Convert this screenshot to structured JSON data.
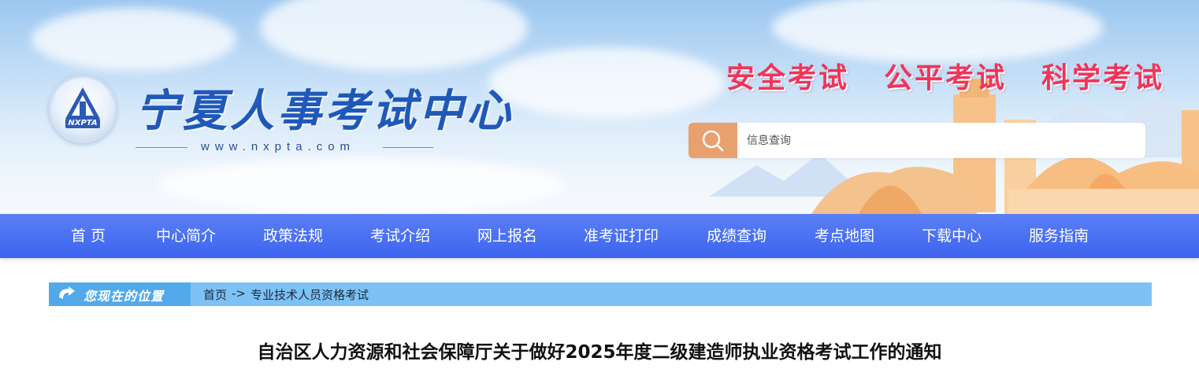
{
  "header": {
    "site_title": "宁夏人事考试中心",
    "site_url": "www.nxpta.com",
    "logo_text": "NXPTA",
    "slogans": [
      "安全考试",
      "公平考试",
      "科学考试"
    ],
    "search": {
      "placeholder": "信息查询",
      "icon": "search-icon"
    }
  },
  "nav": {
    "items": [
      "首 页",
      "中心简介",
      "政策法规",
      "考试介绍",
      "网上报名",
      "准考证打印",
      "成绩查询",
      "考点地图",
      "下载中心",
      "服务指南"
    ]
  },
  "breadcrumb": {
    "label": "您现在的位置",
    "items": [
      "首页",
      "->",
      "专业技术人员资格考试"
    ]
  },
  "article": {
    "title": "自治区人力资源和社会保障厅关于做好2025年度二级建造师执业资格考试工作的通知"
  },
  "colors": {
    "nav_bg": "#3d64ef",
    "slogan": "#f0345a",
    "search_button": "#e8a06e",
    "breadcrumb_bg": "#7dc2f5",
    "title_blue": "#1f58b8"
  }
}
